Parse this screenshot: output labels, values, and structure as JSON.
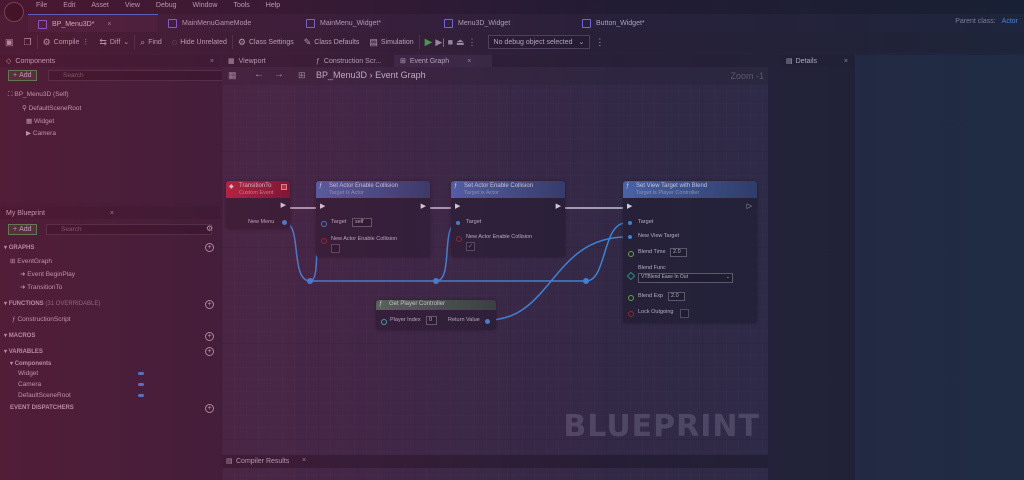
{
  "menubar": {
    "items": [
      "File",
      "Edit",
      "Asset",
      "View",
      "Debug",
      "Window",
      "Tools",
      "Help"
    ],
    "parent_class_label": "Parent class:",
    "parent_class_value": "Actor"
  },
  "tabs": [
    {
      "label": "BP_Menu3D*",
      "active": true
    },
    {
      "label": "MainMenuGameMode",
      "active": false
    },
    {
      "label": "MainMenu_Widget*",
      "active": false
    },
    {
      "label": "Menu3D_Widget",
      "active": false
    },
    {
      "label": "Button_Widget*",
      "active": false
    }
  ],
  "toolbar": {
    "compile": "Compile",
    "diff": "Diff",
    "find": "Find",
    "hide_unrelated": "Hide Unrelated",
    "class_settings": "Class Settings",
    "class_defaults": "Class Defaults",
    "simulation": "Simulation",
    "debug_object": "No debug object selected"
  },
  "components_panel": {
    "title": "Components",
    "add": "Add",
    "search_placeholder": "Search",
    "items": [
      "BP_Menu3D (Self)",
      "DefaultSceneRoot",
      "Widget",
      "Camera"
    ]
  },
  "blueprint_panel": {
    "title": "My Blueprint",
    "add": "Add",
    "search_placeholder": "Search",
    "graphs_label": "GRAPHS",
    "event_graph": "EventGraph",
    "event_begin_play": "Event BeginPlay",
    "transition_to": "TransitionTo",
    "functions_label": "FUNCTIONS",
    "functions_sub": "(31 OVERRIDABLE)",
    "construction_script": "ConstructionScript",
    "macros_label": "MACROS",
    "variables_label": "VARIABLES",
    "components_label": "Components",
    "variables": [
      "Widget",
      "Camera",
      "DefaultSceneRoot"
    ],
    "event_dispatchers_label": "EVENT DISPATCHERS"
  },
  "graph": {
    "tabs": [
      "Viewport",
      "Construction Scr...",
      "Event Graph"
    ],
    "breadcrumb_root": "BP_Menu3D",
    "breadcrumb_sep": "›",
    "breadcrumb_leaf": "Event Graph",
    "zoom": "Zoom -1",
    "watermark": "BLUEPRINT",
    "nodes": {
      "transition": {
        "title": "TransitionTo",
        "subtitle": "Custom Event",
        "pin": "New Menu"
      },
      "collision1": {
        "title": "Set Actor Enable Collision",
        "subtitle": "Target is Actor",
        "target": "Target",
        "target_value": "self",
        "param": "New Actor Enable Collision"
      },
      "collision2": {
        "title": "Set Actor Enable Collision",
        "subtitle": "Target is Actor",
        "target": "Target",
        "param": "New Actor Enable Collision"
      },
      "view_target": {
        "title": "Set View Target with Blend",
        "subtitle": "Target is Player Controller",
        "target": "Target",
        "new_view_target": "New View Target",
        "blend_time": "Blend Time",
        "blend_time_value": "2.0",
        "blend_func": "Blend Func",
        "blend_func_value": "VTBlend Ease In Out",
        "blend_exp": "Blend Exp",
        "blend_exp_value": "2.0",
        "lock_outgoing": "Lock Outgoing"
      },
      "player_controller": {
        "title": "Get Player Controller",
        "player_index": "Player Index",
        "player_index_value": "0",
        "return_value": "Return Value"
      }
    },
    "compiler_results": "Compiler Results"
  },
  "details": {
    "title": "Details"
  }
}
